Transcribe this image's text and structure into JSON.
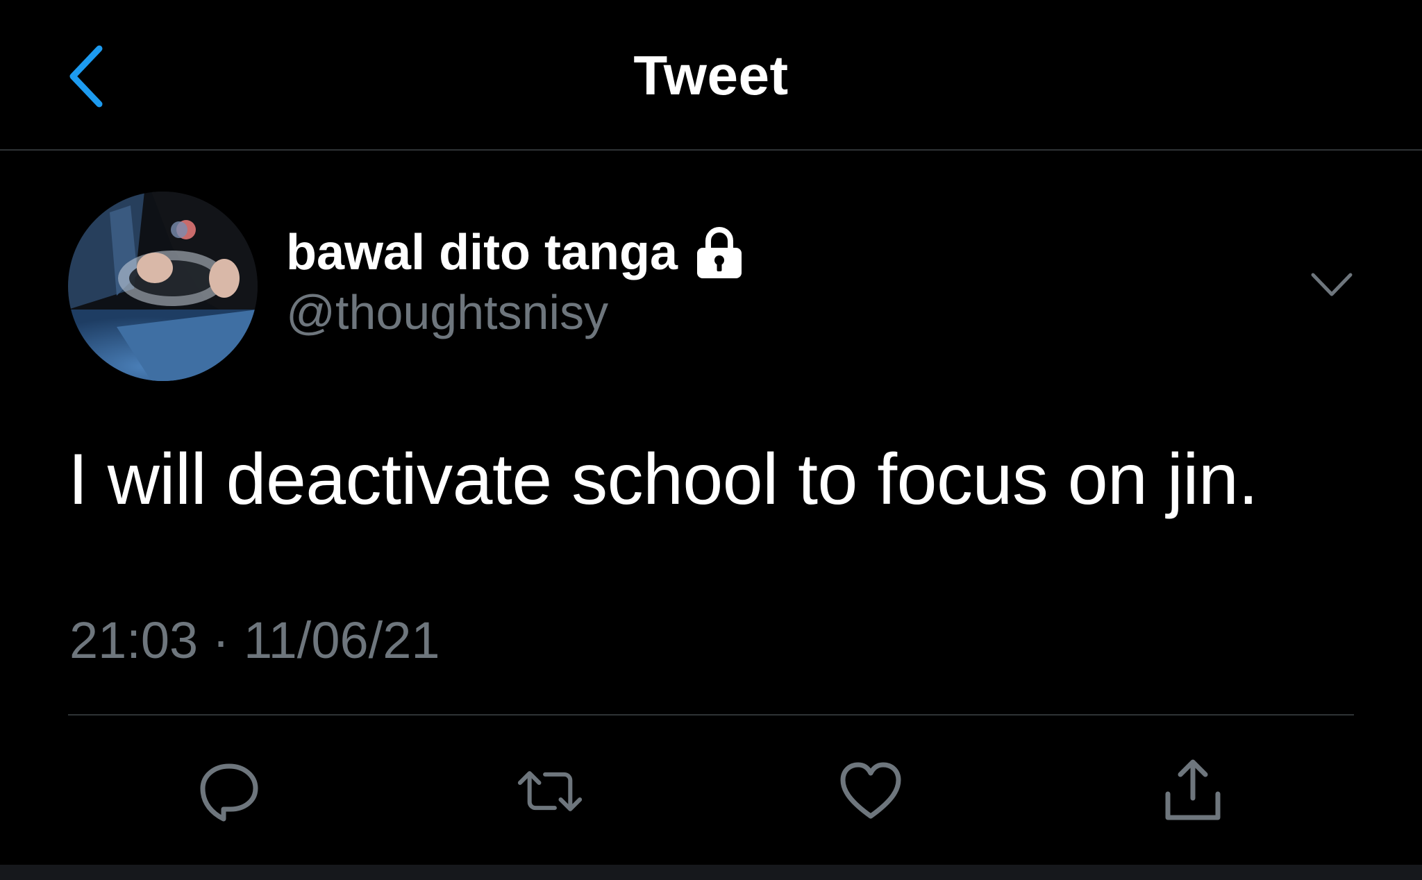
{
  "header": {
    "title": "Tweet",
    "back_icon": "chevron-left-icon"
  },
  "tweet": {
    "display_name": "bawal dito tanga",
    "handle": "@thoughtsnisy",
    "protected_icon": "lock-icon",
    "text": "I will deactivate school to focus on jin.",
    "timestamp": "21:03 · 11/06/21"
  },
  "actions": [
    {
      "name": "reply",
      "icon": "reply-icon"
    },
    {
      "name": "retweet",
      "icon": "retweet-icon"
    },
    {
      "name": "like",
      "icon": "heart-icon"
    },
    {
      "name": "share",
      "icon": "share-icon"
    }
  ],
  "colors": {
    "background": "#000000",
    "accent": "#1d9bf0",
    "secondary_text": "#6e767d",
    "divider": "#2f3336",
    "icon_gray": "#6e767d"
  }
}
